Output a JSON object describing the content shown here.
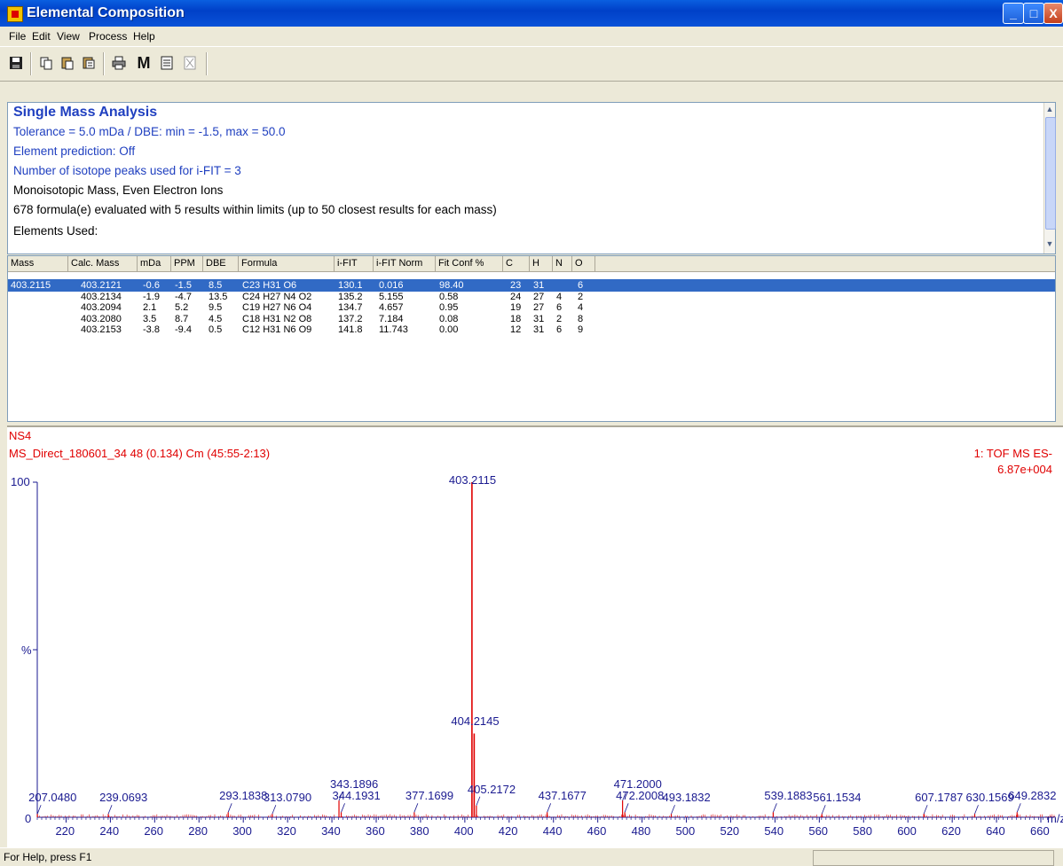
{
  "window": {
    "title": "Elemental Composition",
    "controls": {
      "minimize": "_",
      "maximize": "□",
      "close": "X"
    }
  },
  "menu": [
    "File",
    "Edit",
    "View",
    "Process",
    "Help"
  ],
  "toolbar": {
    "icons": [
      "save-icon",
      "copy-icon",
      "paste-icon",
      "properties-icon",
      "print-icon",
      "mass-icon",
      "list-icon",
      "close-doc-icon"
    ],
    "mass_button_label": "M"
  },
  "analysis": {
    "title": "Single Mass Analysis",
    "tolerance_line": "Tolerance = 5.0 mDa   /   DBE: min = -1.5, max = 50.0",
    "element_prediction": "Element prediction: Off",
    "isotope_peaks": "Number of isotope peaks used for i-FIT = 3",
    "mass_mode": "Monoisotopic Mass, Even Electron Ions",
    "evaluated": "678 formula(e) evaluated with 5 results within limits (up to 50 closest results for each mass)",
    "elements_used": "Elements Used:"
  },
  "table": {
    "headers": [
      "Mass",
      "Calc. Mass",
      "mDa",
      "PPM",
      "DBE",
      "Formula",
      "i-FIT",
      "i-FIT Norm",
      "Fit Conf %",
      "C",
      "H",
      "N",
      "O"
    ],
    "rows": [
      [
        "403.2115",
        "403.2121",
        "-0.6",
        "-1.5",
        "8.5",
        "C23 H31 O6",
        "130.1",
        "0.016",
        "98.40",
        "23",
        "31",
        "",
        "6"
      ],
      [
        "",
        "403.2134",
        "-1.9",
        "-4.7",
        "13.5",
        "C24 H27 N4 O2",
        "135.2",
        "5.155",
        "0.58",
        "24",
        "27",
        "4",
        "2"
      ],
      [
        "",
        "403.2094",
        "2.1",
        "5.2",
        "9.5",
        "C19 H27 N6 O4",
        "134.7",
        "4.657",
        "0.95",
        "19",
        "27",
        "6",
        "4"
      ],
      [
        "",
        "403.2080",
        "3.5",
        "8.7",
        "4.5",
        "C18 H31 N2 O8",
        "137.2",
        "7.184",
        "0.08",
        "18",
        "31",
        "2",
        "8"
      ],
      [
        "",
        "403.2153",
        "-3.8",
        "-9.4",
        "0.5",
        "C12 H31 N6 O9",
        "141.8",
        "11.743",
        "0.00",
        "12",
        "31",
        "6",
        "9"
      ]
    ]
  },
  "spectrum": {
    "sample": "NS4",
    "scan": "MS_Direct_180601_34 48 (0.134) Cm (45:55-2:13)",
    "function": "1: TOF MS ES-",
    "intensity": "6.87e+004",
    "y_top_label": "100",
    "y_mid_label": "%",
    "y_zero_label": "0",
    "x_unit": "m/z",
    "peak_color": "#e00000"
  },
  "chart_data": {
    "type": "bar",
    "title": "",
    "xlabel": "m/z",
    "ylabel": "%",
    "xlim": [
      207,
      666
    ],
    "ylim": [
      0,
      100
    ],
    "x_ticks": [
      220,
      240,
      260,
      280,
      300,
      320,
      340,
      360,
      380,
      400,
      420,
      440,
      460,
      480,
      500,
      520,
      540,
      560,
      580,
      600,
      620,
      640,
      660
    ],
    "peaks": [
      {
        "mz": 207.048,
        "label": "207.0480",
        "intensity": 1
      },
      {
        "mz": 239.0693,
        "label": "239.0693",
        "intensity": 1
      },
      {
        "mz": 293.1838,
        "label": "293.1838",
        "intensity": 1.5
      },
      {
        "mz": 313.079,
        "label": "313.0790",
        "intensity": 1
      },
      {
        "mz": 343.1896,
        "label": "343.1896",
        "intensity": 5
      },
      {
        "mz": 344.1931,
        "label": "344.1931",
        "intensity": 1.5
      },
      {
        "mz": 377.1699,
        "label": "377.1699",
        "intensity": 1.5
      },
      {
        "mz": 403.2115,
        "label": "403.2115",
        "intensity": 100
      },
      {
        "mz": 404.2145,
        "label": "404.2145",
        "intensity": 25
      },
      {
        "mz": 405.2172,
        "label": "405.2172",
        "intensity": 3.5
      },
      {
        "mz": 437.1677,
        "label": "437.1677",
        "intensity": 1.5
      },
      {
        "mz": 471.2,
        "label": "471.2000",
        "intensity": 5
      },
      {
        "mz": 472.2008,
        "label": "472.2008",
        "intensity": 1.5
      },
      {
        "mz": 493.1832,
        "label": "493.1832",
        "intensity": 1
      },
      {
        "mz": 539.1883,
        "label": "539.1883",
        "intensity": 1.5
      },
      {
        "mz": 561.1534,
        "label": "561.1534",
        "intensity": 1
      },
      {
        "mz": 607.1787,
        "label": "607.1787",
        "intensity": 1
      },
      {
        "mz": 630.1569,
        "label": "630.1569",
        "intensity": 1
      },
      {
        "mz": 649.2832,
        "label": "649.2832",
        "intensity": 1.5
      }
    ]
  },
  "status": {
    "help_text": "For Help, press F1"
  }
}
